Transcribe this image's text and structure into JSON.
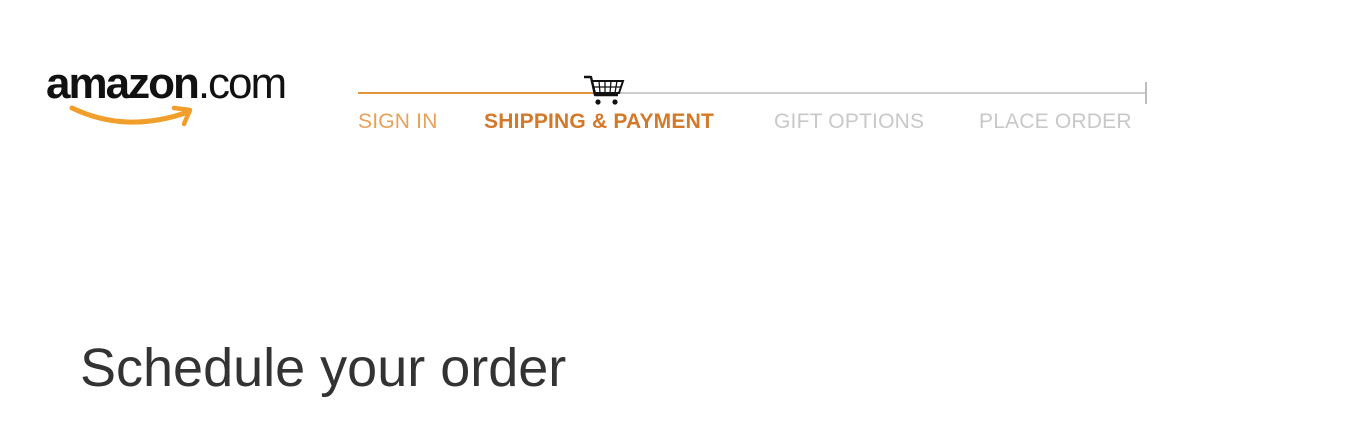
{
  "logo": {
    "brand": "amazon",
    "domain": ".com"
  },
  "checkout_steps": [
    {
      "label": "SIGN IN",
      "state": "completed"
    },
    {
      "label": "SHIPPING & PAYMENT",
      "state": "current"
    },
    {
      "label": "GIFT OPTIONS",
      "state": "upcoming"
    },
    {
      "label": "PLACE ORDER",
      "state": "upcoming"
    }
  ],
  "progress_icon": "shopping-cart-icon",
  "main": {
    "heading": "Schedule your order"
  },
  "colors": {
    "accent": "#e0963c",
    "current_step": "#d4782a",
    "inactive_step": "#c8c8c8",
    "heading": "#333333"
  }
}
